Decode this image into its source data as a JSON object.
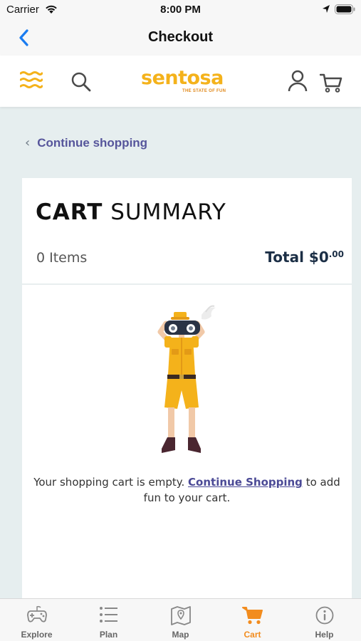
{
  "status_bar": {
    "carrier": "Carrier",
    "time": "8:00 PM"
  },
  "nav": {
    "title": "Checkout",
    "back_icon": "chevron-left-icon"
  },
  "header": {
    "logo_text": "sentosa",
    "logo_tagline": "THE STATE OF FUN",
    "icons": [
      "menu-icon",
      "search-icon",
      "user-icon",
      "cart-icon"
    ]
  },
  "main": {
    "continue_link": "Continue shopping",
    "cart": {
      "title_bold": "CART",
      "title_light": "SUMMARY",
      "items_count": "0 Items",
      "total_label": "Total $0",
      "total_cents": ".00",
      "empty_message_before": "Your shopping cart is empty.",
      "empty_message_link": "Continue Shopping",
      "empty_message_after": "to add fun to your cart."
    }
  },
  "tabs": [
    {
      "label": "Explore",
      "icon": "gamepad-icon"
    },
    {
      "label": "Plan",
      "icon": "list-icon"
    },
    {
      "label": "Map",
      "icon": "map-icon"
    },
    {
      "label": "Cart",
      "icon": "cart-icon",
      "active": true
    },
    {
      "label": "Help",
      "icon": "info-icon"
    }
  ],
  "colors": {
    "brand_yellow": "#f4b21b",
    "brand_orange": "#f28c1e",
    "link_purple": "#56559b",
    "ios_blue": "#1a7cf0",
    "page_bg": "#e6eeef"
  }
}
